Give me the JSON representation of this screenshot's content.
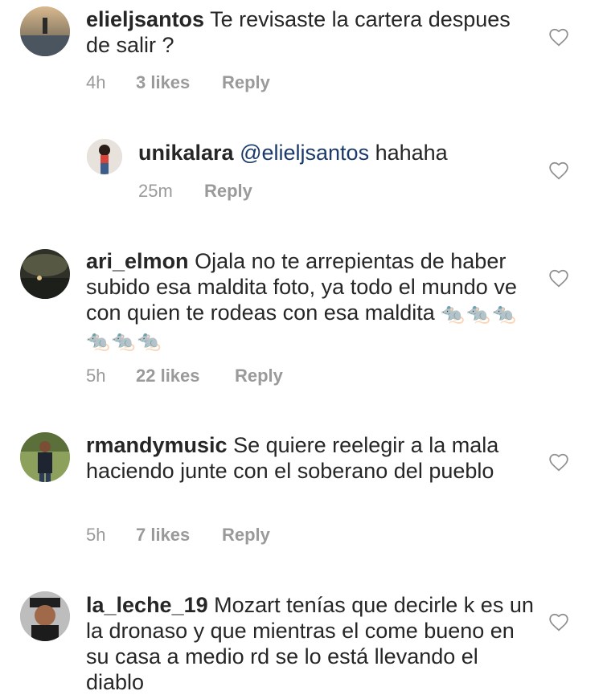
{
  "comments": [
    {
      "username": "elieljsantos",
      "text": "Te revisaste la cartera despues de salir ?",
      "time": "4h",
      "likes": "3 likes",
      "reply": "Reply"
    },
    {
      "username": "unikalara",
      "mention": "@elieljsantos",
      "text": "hahaha",
      "time": "25m",
      "reply": "Reply"
    },
    {
      "username": "ari_elmon",
      "text": "Ojala no te arrepientas de haber subido esa maldita foto, ya todo el mundo ve con quien te rodeas con esa maldita",
      "emoji": "🐀🐀🐀🐀🐀🐀",
      "time": "5h",
      "likes": "22 likes",
      "reply": "Reply"
    },
    {
      "username": "rmandymusic",
      "text": "Se quiere reelegir a la mala haciendo junte con el soberano del pueblo",
      "time": "5h",
      "likes": "7 likes",
      "reply": "Reply"
    },
    {
      "username": "la_leche_19",
      "text": "Mozart tenías que decirle k es un la dronaso y que mientras el come bueno en su casa a medio rd se lo está llevando el diablo"
    }
  ],
  "icons": {
    "like": "heart-outline-icon",
    "avatar": "profile-photo"
  },
  "colors": {
    "text": "#262626",
    "meta": "#9a9a9a",
    "mention": "#1b3a6b"
  }
}
